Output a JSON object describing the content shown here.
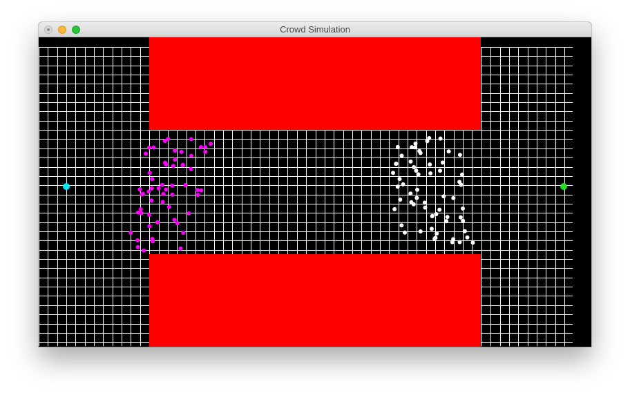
{
  "window": {
    "title": "Crowd Simulation"
  },
  "scene": {
    "background_color": "#000000",
    "grid_color": "#ffffff",
    "obstacle_color": "#ff0000",
    "start_marker": {
      "color": "#00e5ee"
    },
    "goal_marker": {
      "color": "#22dd22"
    },
    "groups": [
      {
        "name": "magenta-agents",
        "color": "#ff00ff",
        "count": 58
      },
      {
        "name": "white-agents",
        "color": "#ffffff",
        "count": 62
      }
    ]
  }
}
